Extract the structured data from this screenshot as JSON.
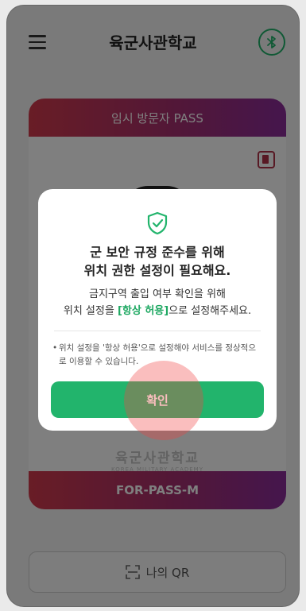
{
  "app": {
    "title": "육군사관학교",
    "menu_icon": "hamburger-menu-icon",
    "bluetooth_icon": "bluetooth-icon",
    "accent": "#20b36a"
  },
  "pass_card": {
    "header": "임시 방문자 PASS",
    "academy_ko": "육군사관학교",
    "academy_en": "KOREA MILITARY ACADEMY",
    "footer": "FOR-PASS-M",
    "gradient_start": "#d23a4c",
    "gradient_end": "#8a2c9a"
  },
  "qr_button": {
    "label": "나의 QR",
    "icon": "qr-scan-icon"
  },
  "modal": {
    "icon": "shield-check-icon",
    "title_line1": "군 보안 규정 준수를 위해",
    "title_line2": "위치 권한 설정이 필요해요.",
    "body_line1": "금지구역 출입 여부 확인을 위해",
    "body_line2_pre": "위치 설정을 ",
    "body_line2_highlight": "[항상 허용]",
    "body_line2_post": "으로 설정해주세요.",
    "note": "위치 설정을 '항상 허용'으로 설정해야 서비스를 정상적으로 이용할 수 있습니다.",
    "confirm_label": "확인",
    "confirm_color": "#22b46c"
  }
}
